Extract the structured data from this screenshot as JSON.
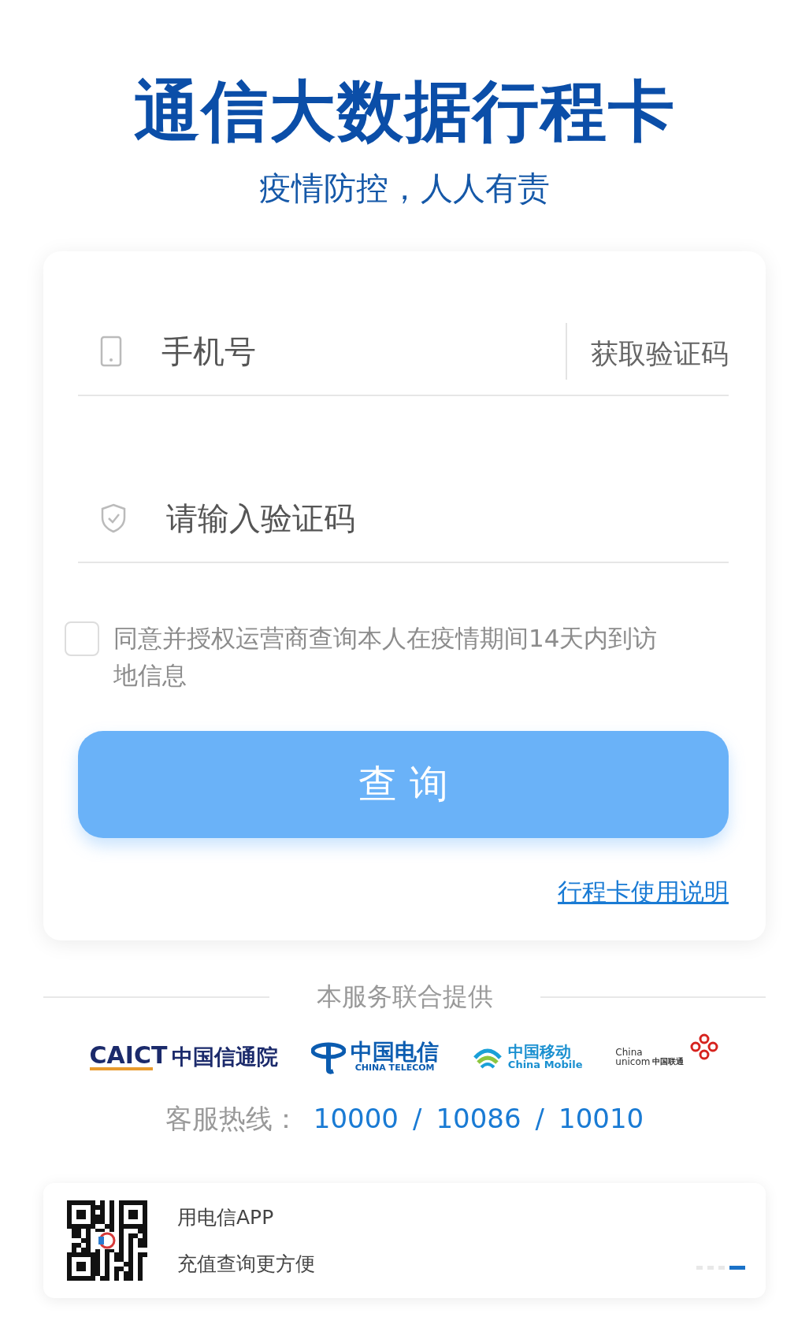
{
  "header": {
    "title": "通信大数据行程卡",
    "subtitle": "疫情防控，人人有责"
  },
  "form": {
    "phone": {
      "placeholder": "手机号"
    },
    "get_code_button": "获取验证码",
    "code": {
      "placeholder": "请输入验证码"
    },
    "agreement": {
      "checked": false,
      "text": "同意并授权运营商查询本人在疫情期间14天内到访地信息"
    },
    "submit_button": "查 询",
    "help_link": "行程卡使用说明"
  },
  "providers": {
    "label": "本服务联合提供",
    "logos": [
      {
        "kind": "caict",
        "texts": [
          "CAICT",
          "中国信通院"
        ]
      },
      {
        "kind": "telecom",
        "texts": [
          "中国电信",
          "CHINA TELECOM"
        ]
      },
      {
        "kind": "mobile",
        "texts": [
          "中国移动",
          "China Mobile"
        ]
      },
      {
        "kind": "unicom",
        "texts": [
          "China",
          "unicom",
          "中国联通"
        ]
      }
    ]
  },
  "hotline": {
    "label": "客服热线：",
    "separator": "/",
    "numbers": [
      "10000",
      "10086",
      "10010"
    ]
  },
  "banner": {
    "lines": [
      "用电信APP",
      "充值查询更方便"
    ],
    "pager": [
      {
        "selected": false
      },
      {
        "selected": false
      },
      {
        "selected": false
      },
      {
        "selected": true
      }
    ]
  }
}
